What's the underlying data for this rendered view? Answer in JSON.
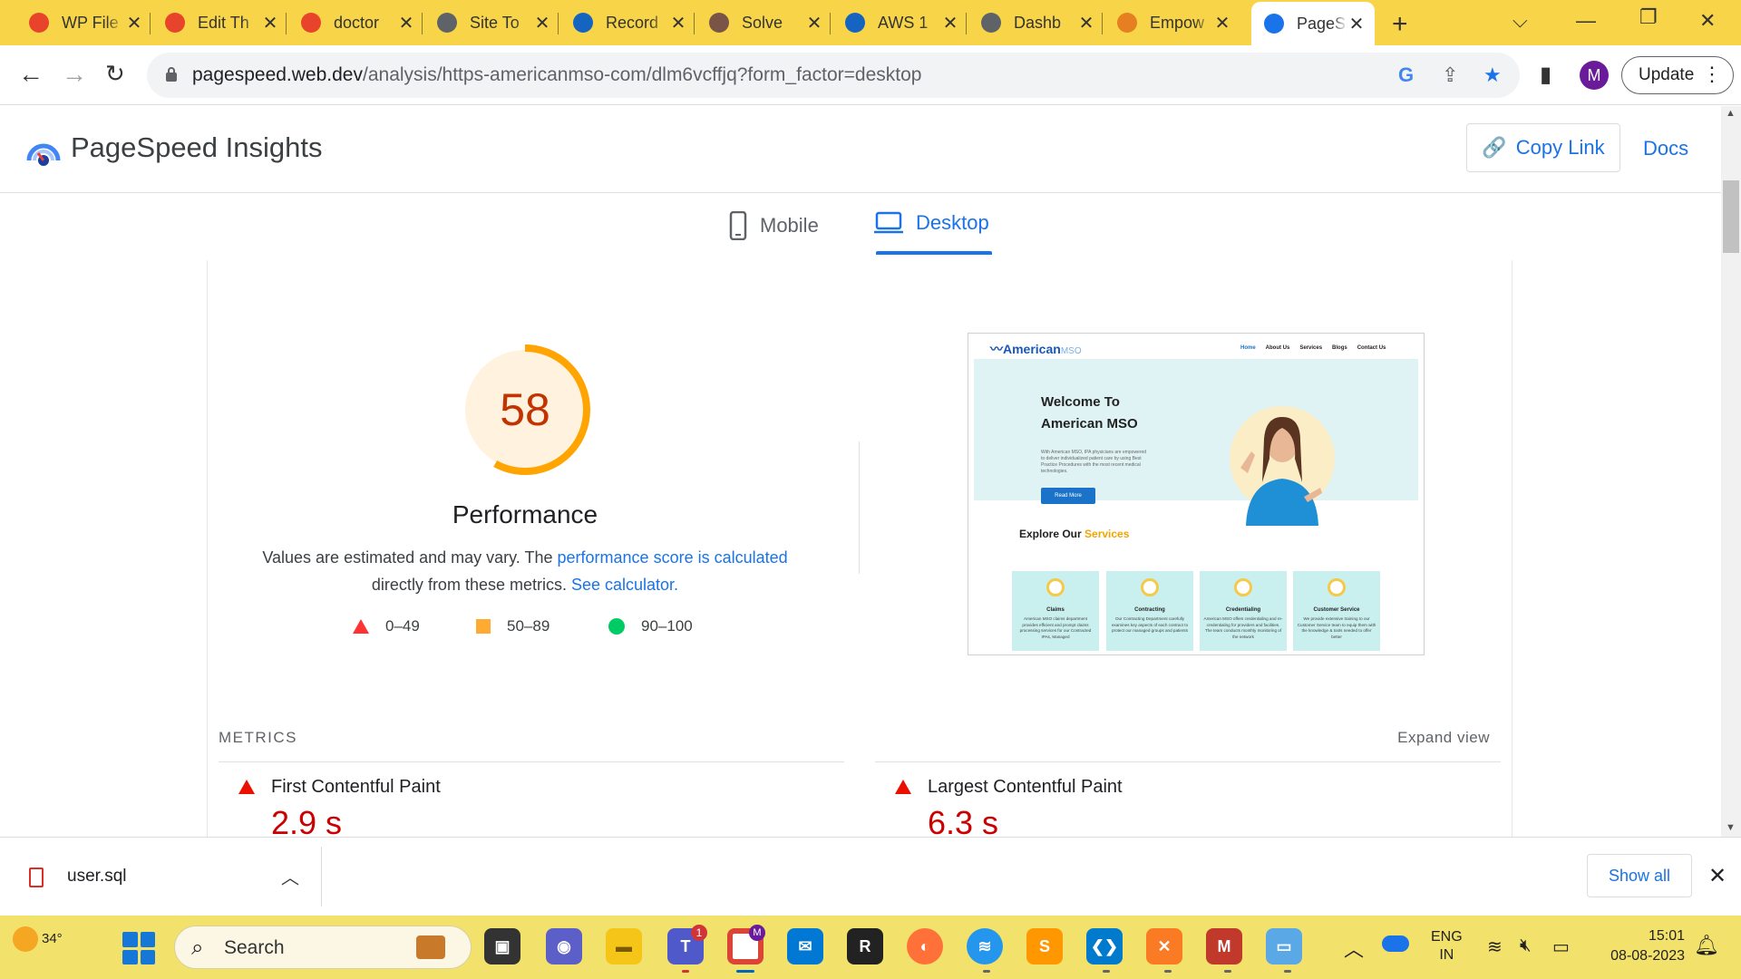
{
  "browser": {
    "tabs": [
      {
        "title": "WP File",
        "favicon_color": "#e8442b"
      },
      {
        "title": "Edit Th",
        "favicon_color": "#e8442b"
      },
      {
        "title": "doctor",
        "favicon_color": "#e8442b"
      },
      {
        "title": "Site To",
        "favicon_color": "#5f6368"
      },
      {
        "title": "Record",
        "favicon_color": "#1565c0"
      },
      {
        "title": "Solve",
        "favicon_color": "#795548"
      },
      {
        "title": "AWS 1",
        "favicon_color": "#1565c0"
      },
      {
        "title": "Dashb",
        "favicon_color": "#5f6368"
      },
      {
        "title": "Empow",
        "favicon_color": "#e67e22"
      },
      {
        "title": "PageSp",
        "favicon_color": "#1a73e8",
        "active": true
      }
    ],
    "url_host": "pagespeed.web.dev",
    "url_path": "/analysis/https-americanmso-com/dlm6vcffjq?form_factor=desktop",
    "avatar_initial": "M",
    "update_label": "Update"
  },
  "psi": {
    "title": "PageSpeed Insights",
    "copy_link": "Copy Link",
    "docs": "Docs",
    "tabs": {
      "mobile": "Mobile",
      "desktop": "Desktop"
    },
    "selected_tab": "desktop"
  },
  "performance": {
    "score": 58,
    "score_color": "#c33300",
    "gauge_color": "#ffa400",
    "label": "Performance",
    "desc_1": "Values are estimated and may vary. The ",
    "desc_link_1": "performance score is calculated",
    "desc_2": "directly from these metrics. ",
    "desc_link_2": "See calculator.",
    "legend": [
      {
        "range": "0–49",
        "shape": "triangle",
        "color": "#ff3333"
      },
      {
        "range": "50–89",
        "shape": "square",
        "color": "#ffaa33"
      },
      {
        "range": "90–100",
        "shape": "circle",
        "color": "#00cc66"
      }
    ]
  },
  "screenshot": {
    "logo_text": "American",
    "logo_suffix": "MSO",
    "nav": [
      "Home",
      "About Us",
      "Services",
      "Blogs",
      "Contact Us"
    ],
    "hero_title_1": "Welcome To",
    "hero_title_2": "American MSO",
    "hero_text": "With American MSO, IPA physicians are empowered to deliver individualized patient care by using Best Practice Procedures with the most recent medical technologies.",
    "read_more": "Read More",
    "explore_1": "Explore Our ",
    "explore_2": "Services",
    "cards": [
      {
        "title": "Claims",
        "desc": "American MSO claims department provides efficient and prompt claims processing services for our Contracted IPAs, Managed"
      },
      {
        "title": "Contracting",
        "desc": "Our Contracting Department carefully examines key aspects of each contract to protect our managed groups and patients"
      },
      {
        "title": "Credentialing",
        "desc": "American MSO offers credentialing and re-credentialing for providers and facilities. The team conducts monthly monitoring of the network"
      },
      {
        "title": "Customer Service",
        "desc": "We provide extensive training to our Customer Service team to equip them with the knowledge & tools needed to offer better"
      }
    ]
  },
  "metrics": {
    "section_label": "METRICS",
    "expand": "Expand view",
    "items": [
      {
        "name": "First Contentful Paint",
        "value": "2.9 s",
        "status": "fail"
      },
      {
        "name": "Largest Contentful Paint",
        "value": "6.3 s",
        "status": "fail"
      }
    ]
  },
  "download_bar": {
    "file_name": "user.sql",
    "show_all": "Show all"
  },
  "taskbar": {
    "weather_temp": "34°",
    "search_placeholder": "Search",
    "teams_badge": "1",
    "chrome_badge": "M",
    "lang_1": "ENG",
    "lang_2": "IN",
    "time": "15:01",
    "date": "08-08-2023"
  }
}
